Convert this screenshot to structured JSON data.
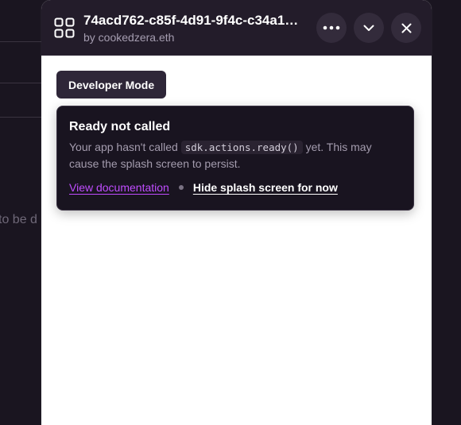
{
  "background": {
    "partial_text": "to be d"
  },
  "miniapp": {
    "title": "74acd762-c85f-4d91-9f4c-c34a1…",
    "author": "by cookedzera.eth",
    "icon": "app-grid-icon",
    "actions": {
      "more_icon": "more-horizontal-icon",
      "collapse_icon": "chevron-down-icon",
      "close_icon": "close-icon"
    }
  },
  "content": {
    "developer_mode_label": "Developer Mode",
    "warning": {
      "title": "Ready not called",
      "text_before": "Your app hasn't called ",
      "code": "sdk.actions.ready()",
      "text_after": " yet. This may cause the splash screen to persist.",
      "link_docs": "View documentation",
      "link_hide": "Hide splash screen for now"
    }
  },
  "colors": {
    "header_bg": "#231c2a",
    "accent_link": "#c04dff",
    "card_bg": "#191420",
    "dev_button_bg": "#2e2638"
  }
}
